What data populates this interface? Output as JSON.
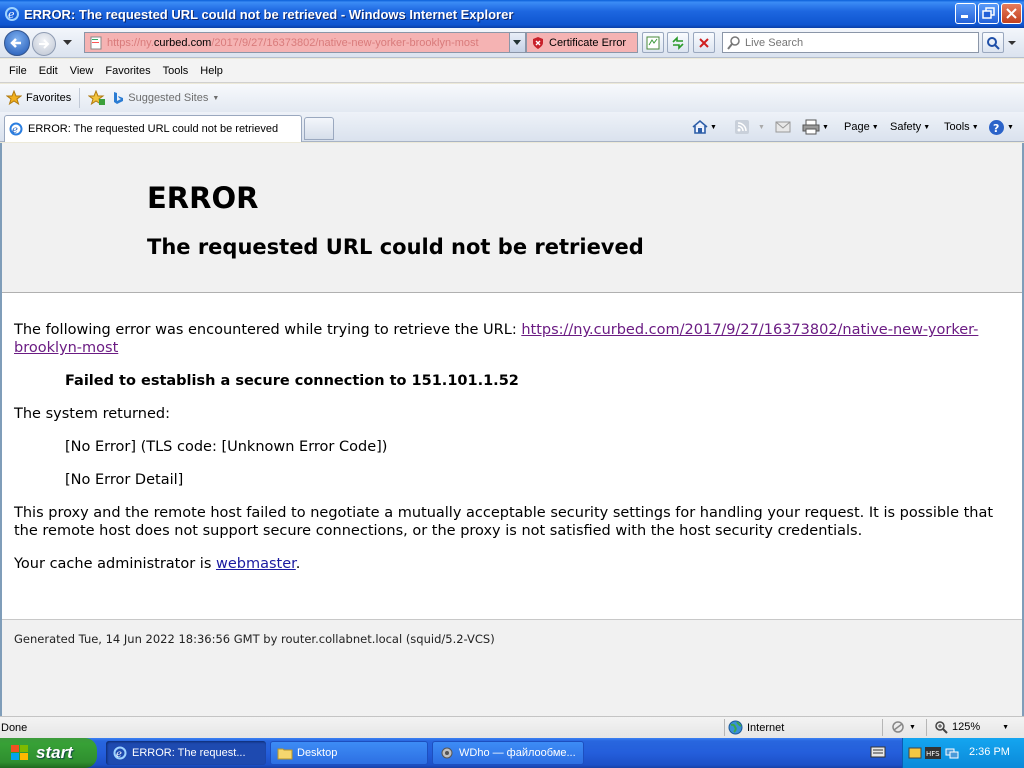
{
  "window": {
    "title": "ERROR: The requested URL could not be retrieved - Windows Internet Explorer",
    "minimize_icon": "minimize-icon",
    "maximize_icon": "maximize-icon",
    "close_icon": "close-icon"
  },
  "address_bar": {
    "url_prefix": "https://ny.",
    "url_domain": "curbed.com",
    "url_rest": "/2017/9/27/16373802/native-new-yorker-brooklyn-most",
    "cert_error": "Certificate Error",
    "search_placeholder": "Live Search"
  },
  "menu": {
    "items": [
      "File",
      "Edit",
      "View",
      "Favorites",
      "Tools",
      "Help"
    ]
  },
  "favorites_bar": {
    "favorites_label": "Favorites",
    "suggested_label": "Suggested Sites"
  },
  "tab": {
    "title": "ERROR: The requested URL could not be retrieved"
  },
  "command_bar": {
    "page": "Page",
    "safety": "Safety",
    "tools": "Tools"
  },
  "page": {
    "heading": "ERROR",
    "subheading": "The requested URL could not be retrieved",
    "intro": "The following error was encountered while trying to retrieve the URL: ",
    "url_link": "https://ny.curbed.com/2017/9/27/16373802/native-new-yorker-brooklyn-most",
    "failure": "Failed to establish a secure connection to 151.101.1.52",
    "system_returned": "The system returned:",
    "error_code": "[No Error] (TLS code: [Unknown Error Code])",
    "error_detail": "[No Error Detail]",
    "explanation": "This proxy and the remote host failed to negotiate a mutually acceptable security settings for handling your request. It is possible that the remote host does not support secure connections, or the proxy is not satisfied with the host security credentials.",
    "admin_text": "Your cache administrator is ",
    "admin_link": "webmaster",
    "admin_end": ".",
    "generated": "Generated Tue, 14 Jun 2022 18:36:56 GMT by router.collabnet.local (squid/5.2-VCS)"
  },
  "status_bar": {
    "status": "Done",
    "zone": "Internet",
    "zoom": "125%"
  },
  "taskbar": {
    "start": "start",
    "tasks": [
      {
        "label": "ERROR: The request..."
      },
      {
        "label": "Desktop"
      },
      {
        "label": "WDho — файлообме..."
      }
    ],
    "clock": "2:36 PM"
  }
}
